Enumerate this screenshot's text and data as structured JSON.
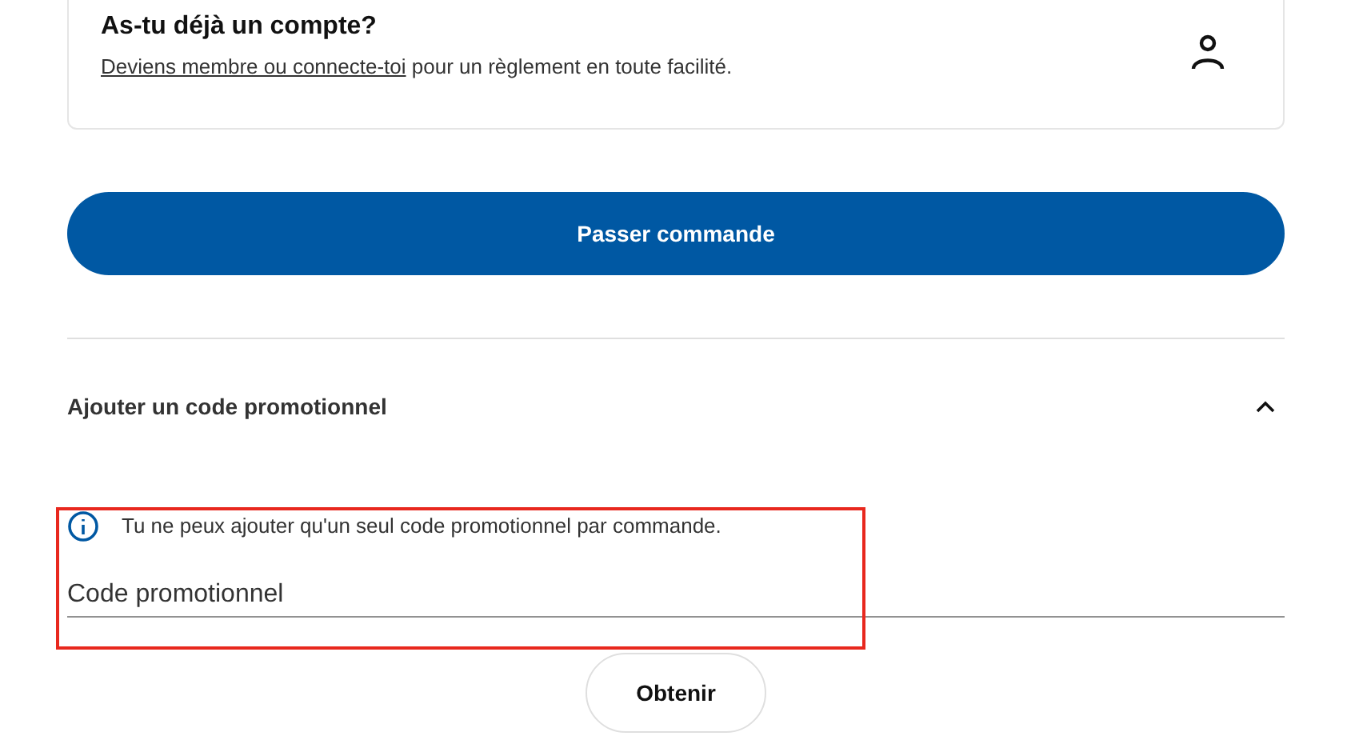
{
  "account_card": {
    "title": "As-tu déjà un compte?",
    "link": "Deviens membre ou connecte-toi",
    "text": " pour un règlement en toute facilité."
  },
  "checkout_button": {
    "label": "Passer commande"
  },
  "promo_section": {
    "title": "Ajouter un code promotionnel",
    "expanded": true,
    "info": "Tu ne peux ajouter qu'un seul code promotionnel par commande.",
    "field": {
      "placeholder": "Code promotionnel"
    },
    "highlighted": true,
    "button": {
      "label": "Obtenir"
    }
  }
}
